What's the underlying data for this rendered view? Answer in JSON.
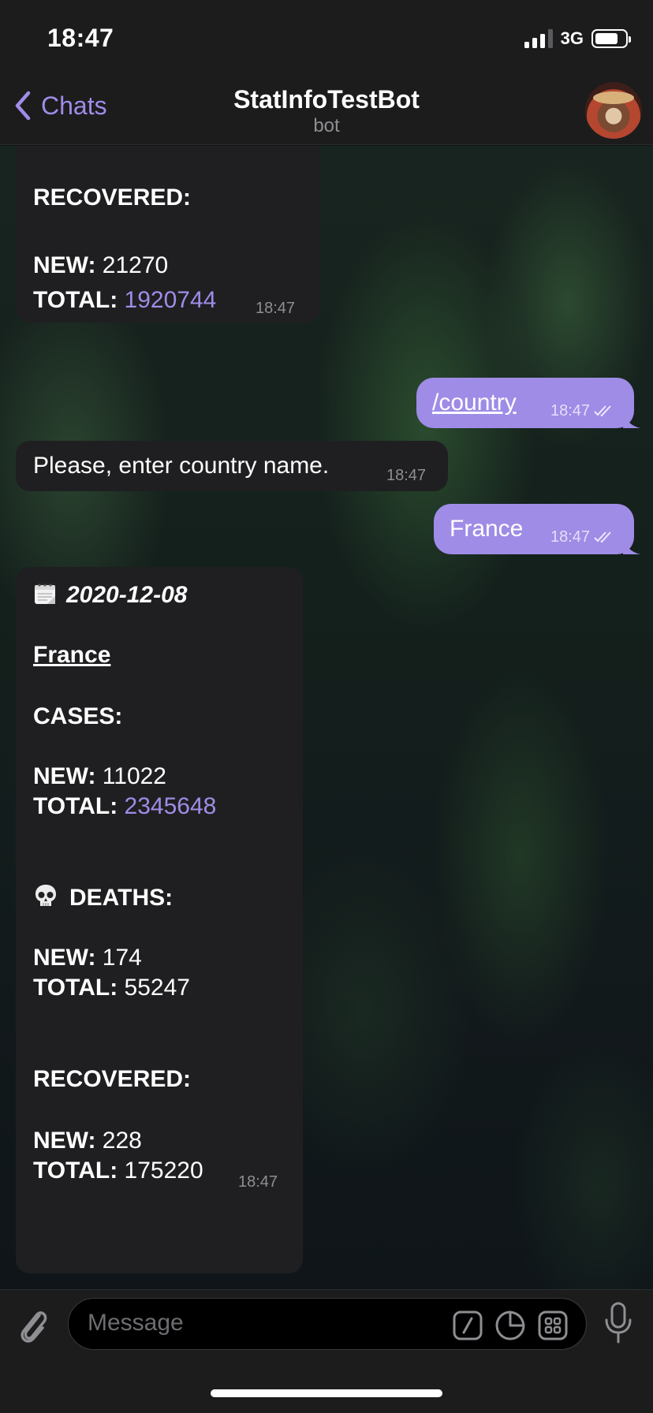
{
  "status": {
    "time": "18:47",
    "network": "3G"
  },
  "nav": {
    "back_label": "Chats",
    "title": "StatInfoTestBot",
    "subtitle": "bot"
  },
  "messages": {
    "m1": {
      "recovered_label": "RECOVERED:",
      "new_label": "NEW:",
      "new_value": "21270",
      "total_label": "TOTAL:",
      "total_value": "1920744",
      "time": "18:47"
    },
    "m2": {
      "text": "/country",
      "time": "18:47"
    },
    "m3": {
      "text": "Please, enter country name.",
      "time": "18:47"
    },
    "m4": {
      "text": "France",
      "time": "18:47"
    },
    "m5": {
      "date": "2020-12-08",
      "country": "France",
      "cases_label": "CASES:",
      "cases_new_label": "NEW:",
      "cases_new_value": "11022",
      "cases_total_label": "TOTAL:",
      "cases_total_value": "2345648",
      "deaths_label": "DEATHS:",
      "deaths_new_label": "NEW:",
      "deaths_new_value": "174",
      "deaths_total_label": "TOTAL:",
      "deaths_total_value": "55247",
      "recovered_label": "RECOVERED:",
      "recovered_new_label": "NEW:",
      "recovered_new_value": "228",
      "recovered_total_label": "TOTAL:",
      "recovered_total_value": "175220",
      "time": "18:47"
    }
  },
  "input": {
    "placeholder": "Message"
  },
  "icons": {
    "back": "chevron-left-icon",
    "attach": "paperclip-icon",
    "command": "slash-command-icon",
    "sticker": "sticker-icon",
    "bot_menu": "bot-keyboard-icon",
    "mic": "microphone-icon",
    "calendar": "calendar-emoji-icon",
    "skull": "skull-emoji-icon",
    "read": "double-check-icon"
  },
  "colors": {
    "accent": "#a08ce8",
    "outgoing_bubble": "#9f8ce6",
    "incoming_bubble": "#1f1f21",
    "bar": "#1c1c1d"
  }
}
